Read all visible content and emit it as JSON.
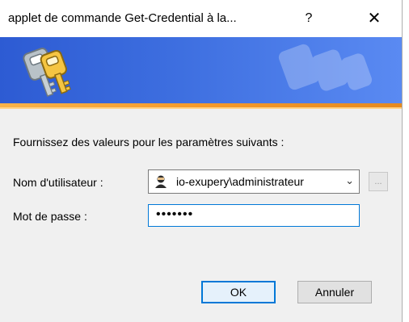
{
  "window": {
    "title": "applet de commande Get-Credential à la...",
    "help_label": "?",
    "close_label": "✕"
  },
  "form": {
    "prompt": "Fournissez des valeurs pour les paramètres suivants :",
    "username_label": "Nom d'utilisateur :",
    "username_value": "io-exupery\\administrateur",
    "browse_label": "...",
    "password_label": "Mot de passe :",
    "password_value": "•••••••"
  },
  "buttons": {
    "ok": "OK",
    "cancel": "Annuler"
  },
  "colors": {
    "banner": "#3e6fe0",
    "accent_stripe": "#f59a2a",
    "focus": "#0078d7"
  },
  "icons": {
    "banner": "keys-icon",
    "user": "user-icon",
    "combo": "chevron-down-icon"
  }
}
